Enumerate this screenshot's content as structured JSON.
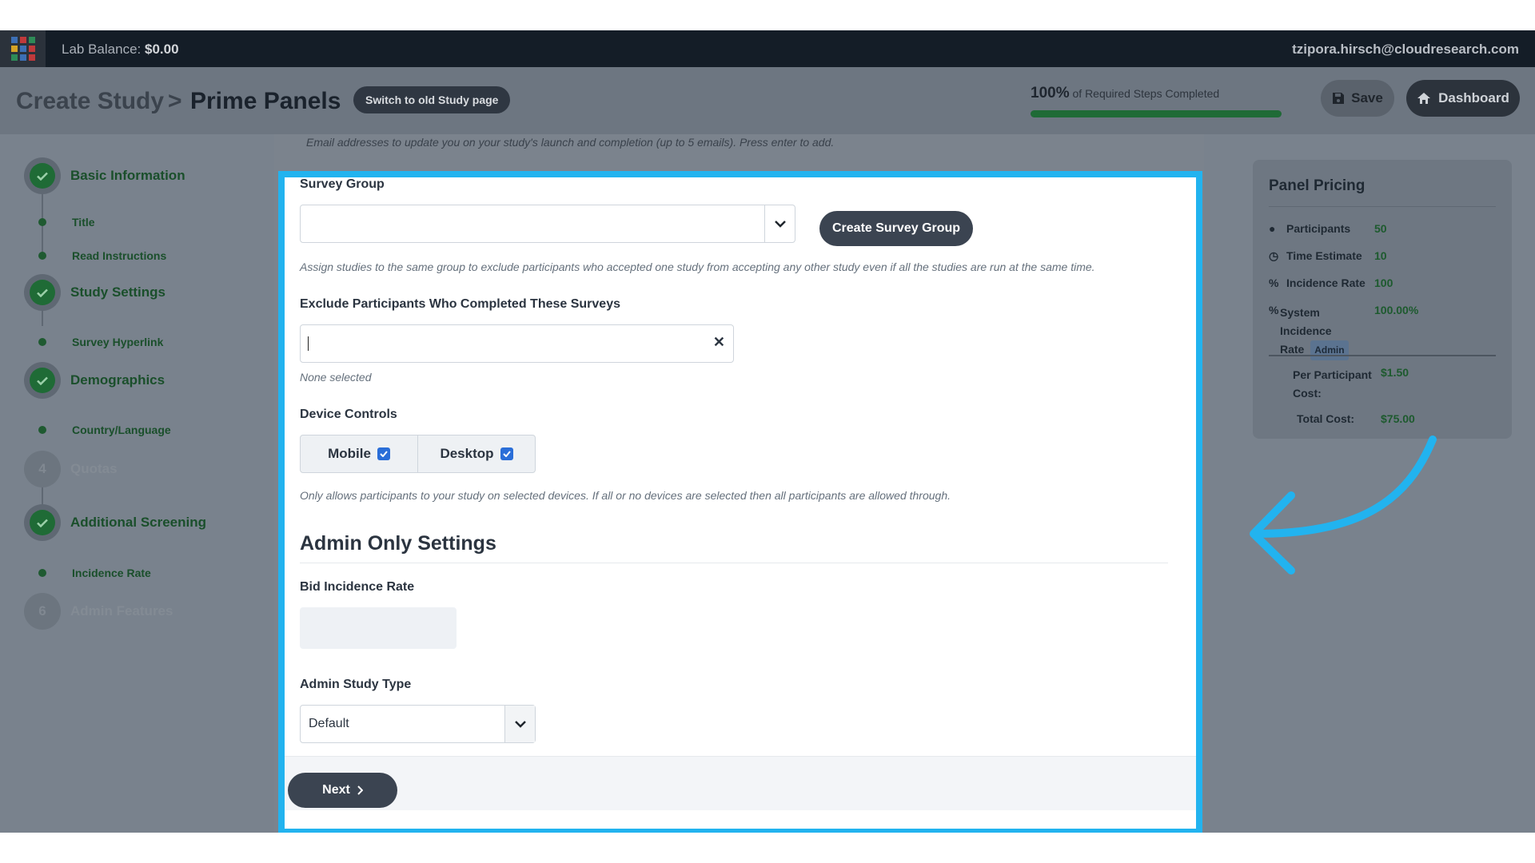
{
  "topbar": {
    "balance_label": "Lab Balance:",
    "balance_value": "$0.00",
    "user_email": "tzipora.hirsch@cloudresearch.com"
  },
  "header": {
    "breadcrumb_parent": "Create Study",
    "breadcrumb_separator": ">",
    "breadcrumb_current": "Prime Panels",
    "switch_button": "Switch to old Study page",
    "progress_percent_text": "100%",
    "progress_label": "of Required Steps Completed",
    "progress_fraction": 1.0,
    "save_button": "Save",
    "dashboard_button": "Dashboard"
  },
  "sidebar": {
    "steps": [
      {
        "label": "Basic Information",
        "status": "complete"
      },
      {
        "label": "Study Settings",
        "status": "complete"
      },
      {
        "label": "Demographics",
        "status": "complete"
      },
      {
        "label": "Quotas",
        "status": "disabled",
        "number": "4"
      },
      {
        "label": "Additional Screening",
        "status": "complete"
      },
      {
        "label": "Admin Features",
        "status": "disabled",
        "number": "6"
      }
    ],
    "substeps": {
      "basic": [
        "Title",
        "Read Instructions"
      ],
      "settings": [
        "Survey Hyperlink"
      ],
      "demographics": [
        "Country/Language"
      ],
      "screening": [
        "Incidence Rate"
      ]
    }
  },
  "form": {
    "email_hint": "Email addresses to update you on your study's launch and completion (up to 5 emails). Press enter to add.",
    "survey_group": {
      "label": "Survey Group",
      "value": "",
      "create_button": "Create Survey Group",
      "help": "Assign studies to the same group to exclude participants who accepted one study from accepting any other study even if all the studies are run at the same time."
    },
    "exclude": {
      "label": "Exclude Participants Who Completed These Surveys",
      "value": "",
      "help": "None selected"
    },
    "device_controls": {
      "label": "Device Controls",
      "options": [
        {
          "label": "Mobile",
          "checked": true
        },
        {
          "label": "Desktop",
          "checked": true
        }
      ],
      "help": "Only allows participants to your study on selected devices. If all or no devices are selected then all participants are allowed through."
    },
    "admin_settings": {
      "title": "Admin Only Settings",
      "bid_incidence_label": "Bid Incidence Rate",
      "bid_incidence_value": "",
      "study_type_label": "Admin Study Type",
      "study_type_value": "Default"
    },
    "next_button": "Next"
  },
  "pricing": {
    "title": "Panel Pricing",
    "rows": [
      {
        "icon": "user-icon",
        "label": "Participants",
        "value": "50"
      },
      {
        "icon": "clock-icon",
        "label": "Time Estimate",
        "value": "10"
      },
      {
        "icon": "percent-icon",
        "label": "Incidence Rate",
        "value": "100"
      }
    ],
    "system_incidence_label_1": "System Incidence",
    "system_incidence_label_2": "Rate",
    "system_incidence_tag": "Admin",
    "system_incidence_value": "100.00%",
    "per_participant_label_1": "Per Participant",
    "per_participant_label_2": "Cost:",
    "per_participant_value": "$1.50",
    "total_label": "Total Cost:",
    "total_value": "$75.00"
  },
  "colors": {
    "highlight": "#22b3ef",
    "success_green": "#1f6b36",
    "dark_button": "#3b4451"
  }
}
